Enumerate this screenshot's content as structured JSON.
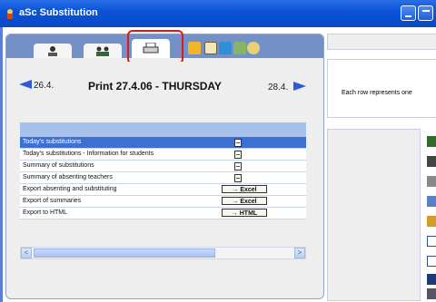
{
  "window": {
    "title": "aSc Substitution"
  },
  "colors": {
    "title_bar": "#0a53d8",
    "selected_row": "#3e6fd3",
    "highlight": "#e0191b",
    "arrow": "#2d5bd8"
  },
  "tabs": [
    {
      "icon": "teacher-icon"
    },
    {
      "icon": "group-icon"
    },
    {
      "icon": "printer-icon",
      "active": true
    },
    {
      "icon": "absence-icon"
    },
    {
      "icon": "books-icon"
    },
    {
      "icon": "pin-icon"
    },
    {
      "icon": "disk-icon"
    }
  ],
  "nav": {
    "prev": "26.4.",
    "title": "Print 27.4.06 - THURSDAY",
    "next": "28.4."
  },
  "rows": [
    {
      "label": "Today's substitutions",
      "action": "preview",
      "selected": true
    },
    {
      "label": "Today's substitutions - Information for students",
      "action": "preview"
    },
    {
      "label": "Summary of substitutions",
      "action": "preview"
    },
    {
      "label": "Summary of absenting teachers",
      "action": "preview"
    },
    {
      "label": "Export absenting and substituting",
      "action": "→ Excel"
    },
    {
      "label": "Export of summaries",
      "action": "→ Excel"
    },
    {
      "label": "Export to HTML",
      "action": "→ HTML"
    }
  ],
  "right": {
    "info": "Each row represents one"
  }
}
